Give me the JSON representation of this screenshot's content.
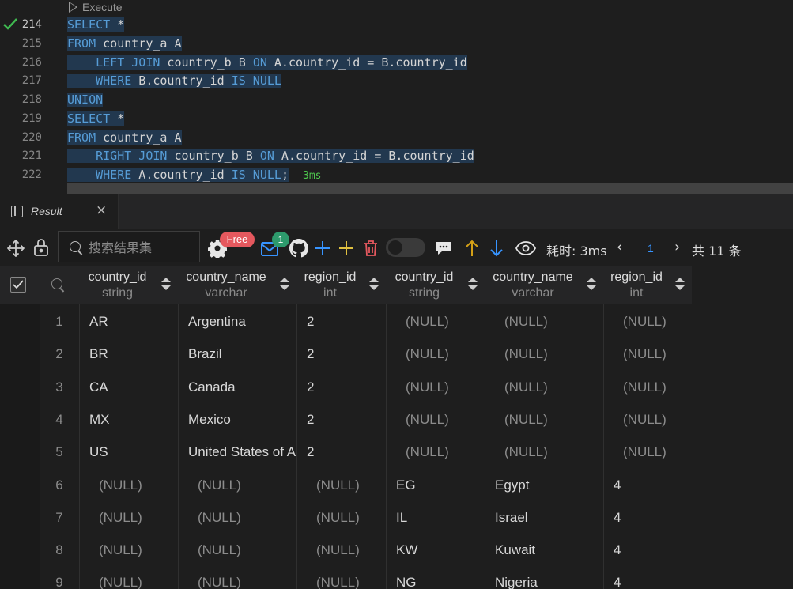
{
  "editor": {
    "codelens": "Execute",
    "lines": [
      {
        "num": "214",
        "active": true,
        "tokens": [
          [
            "kw",
            "SELECT"
          ],
          [
            "t",
            " *"
          ]
        ]
      },
      {
        "num": "215",
        "tokens": [
          [
            "kw",
            "FROM"
          ],
          [
            "t",
            " country_a A"
          ]
        ]
      },
      {
        "num": "216",
        "tokens": [
          [
            "t",
            "    "
          ],
          [
            "kw",
            "LEFT JOIN"
          ],
          [
            "t",
            " country_b B "
          ],
          [
            "kw",
            "ON"
          ],
          [
            "t",
            " A.country_id = B.country_id"
          ]
        ]
      },
      {
        "num": "217",
        "tokens": [
          [
            "t",
            "    "
          ],
          [
            "kw",
            "WHERE"
          ],
          [
            "t",
            " B.country_id "
          ],
          [
            "kw",
            "IS NULL"
          ]
        ]
      },
      {
        "num": "218",
        "tokens": [
          [
            "kw",
            "UNION"
          ]
        ]
      },
      {
        "num": "219",
        "tokens": [
          [
            "kw",
            "SELECT"
          ],
          [
            "t",
            " *"
          ]
        ]
      },
      {
        "num": "220",
        "tokens": [
          [
            "kw",
            "FROM"
          ],
          [
            "t",
            " country_a A"
          ]
        ]
      },
      {
        "num": "221",
        "tokens": [
          [
            "t",
            "    "
          ],
          [
            "kw",
            "RIGHT JOIN"
          ],
          [
            "t",
            " country_b B "
          ],
          [
            "kw",
            "ON"
          ],
          [
            "t",
            " A.country_id = B.country_id"
          ]
        ]
      },
      {
        "num": "222",
        "tokens": [
          [
            "t",
            "    "
          ],
          [
            "kw",
            "WHERE"
          ],
          [
            "t",
            " A.country_id "
          ],
          [
            "kw",
            "IS NULL"
          ],
          [
            "t",
            ";"
          ]
        ],
        "timing": "3ms"
      }
    ]
  },
  "result_tab": {
    "label": "Result",
    "close": "×"
  },
  "toolbar": {
    "search_placeholder": "搜索结果集",
    "free_badge": "Free",
    "mail_badge": "1",
    "elapsed": "耗时: 3ms",
    "prev": "‹",
    "page": "1",
    "next": "›",
    "total": "共 11 条"
  },
  "table": {
    "columns": [
      {
        "name": "country_id",
        "type": "string"
      },
      {
        "name": "country_name",
        "type": "varchar"
      },
      {
        "name": "region_id",
        "type": "int"
      },
      {
        "name": "country_id",
        "type": "string"
      },
      {
        "name": "country_name",
        "type": "varchar"
      },
      {
        "name": "region_id",
        "type": "int"
      }
    ],
    "rows": [
      [
        "1",
        "AR",
        "Argentina",
        "2",
        "(NULL)",
        "(NULL)",
        "(NULL)"
      ],
      [
        "2",
        "BR",
        "Brazil",
        "2",
        "(NULL)",
        "(NULL)",
        "(NULL)"
      ],
      [
        "3",
        "CA",
        "Canada",
        "2",
        "(NULL)",
        "(NULL)",
        "(NULL)"
      ],
      [
        "4",
        "MX",
        "Mexico",
        "2",
        "(NULL)",
        "(NULL)",
        "(NULL)"
      ],
      [
        "5",
        "US",
        "United States of A",
        "2",
        "(NULL)",
        "(NULL)",
        "(NULL)"
      ],
      [
        "6",
        "(NULL)",
        "(NULL)",
        "(NULL)",
        "EG",
        "Egypt",
        "4"
      ],
      [
        "7",
        "(NULL)",
        "(NULL)",
        "(NULL)",
        "IL",
        "Israel",
        "4"
      ],
      [
        "8",
        "(NULL)",
        "(NULL)",
        "(NULL)",
        "KW",
        "Kuwait",
        "4"
      ],
      [
        "9",
        "(NULL)",
        "(NULL)",
        "(NULL)",
        "NG",
        "Nigeria",
        "4"
      ]
    ]
  },
  "colors": {
    "keyword": "#569cd6",
    "selection": "#264f78",
    "accent": "#3794ff",
    "free": "#e5585e",
    "success": "#4ec94e"
  }
}
